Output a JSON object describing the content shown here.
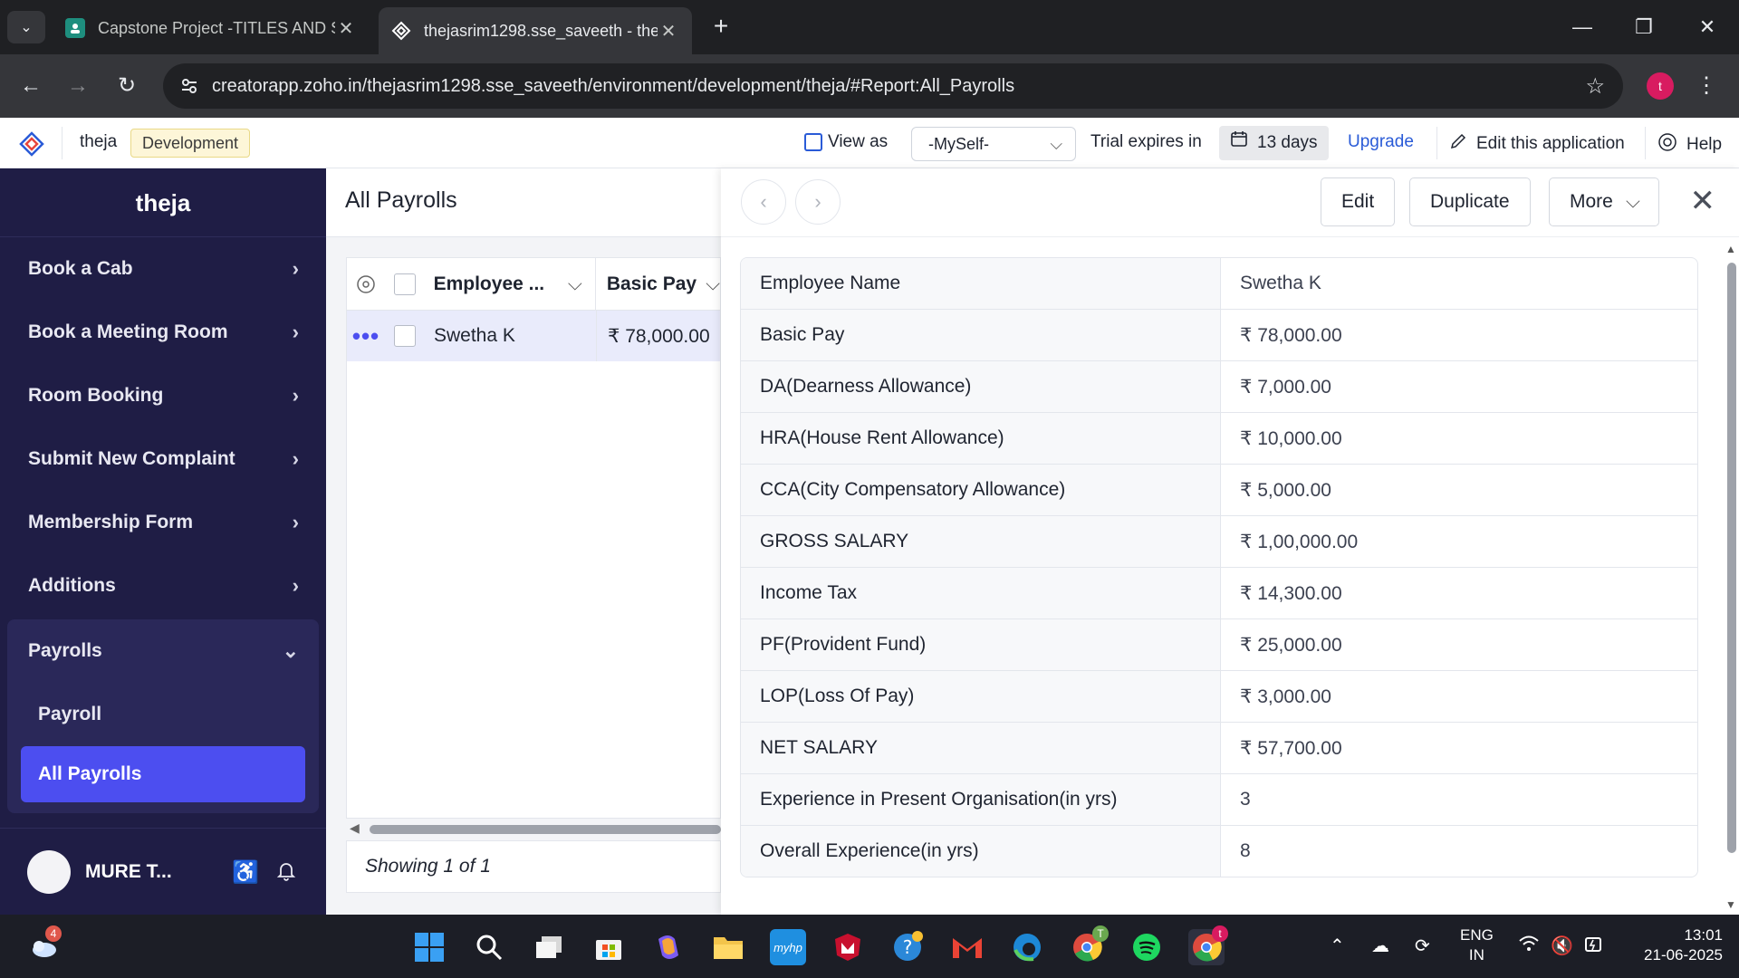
{
  "browser": {
    "tabs": [
      {
        "title": "Capstone Project -TITLES AND S",
        "active": false
      },
      {
        "title": "thejasrim1298.sse_saveeth - the",
        "active": true
      }
    ],
    "url": "creatorapp.zoho.in/thejasrim1298.sse_saveeth/environment/development/theja/#Report:All_Payrolls",
    "profile_initial": "t"
  },
  "app_header": {
    "app_name": "theja",
    "env_badge": "Development",
    "view_as_label": "View as",
    "view_as_value": "-MySelf-",
    "trial_label": "Trial expires in",
    "trial_days": "13 days",
    "upgrade_label": "Upgrade",
    "edit_app_label": "Edit this application",
    "help_label": "Help"
  },
  "sidebar": {
    "title": "theja",
    "items": [
      {
        "label": "Book a Cab"
      },
      {
        "label": "Book a Meeting Room"
      },
      {
        "label": "Room Booking"
      },
      {
        "label": "Submit New Complaint"
      },
      {
        "label": "Membership Form"
      },
      {
        "label": "Additions"
      }
    ],
    "group": {
      "label": "Payrolls",
      "children": [
        {
          "label": "Payroll",
          "active": false
        },
        {
          "label": "All Payrolls",
          "active": true
        }
      ]
    },
    "user_name": "MURE T..."
  },
  "report": {
    "title": "All Payrolls",
    "columns": [
      "Employee ...",
      "Basic Pay"
    ],
    "rows": [
      {
        "employee": "Swetha K",
        "basic_pay": "₹ 78,000.00"
      }
    ],
    "footer": "Showing 1 of 1"
  },
  "detail": {
    "buttons": {
      "edit": "Edit",
      "duplicate": "Duplicate",
      "more": "More"
    },
    "fields": [
      {
        "label": "Employee Name",
        "value": "Swetha K"
      },
      {
        "label": "Basic Pay",
        "value": "₹ 78,000.00"
      },
      {
        "label": "DA(Dearness Allowance)",
        "value": "₹ 7,000.00"
      },
      {
        "label": "HRA(House Rent Allowance)",
        "value": "₹ 10,000.00"
      },
      {
        "label": "CCA(City Compensatory Allowance)",
        "value": "₹ 5,000.00"
      },
      {
        "label": "GROSS SALARY",
        "value": "₹ 1,00,000.00"
      },
      {
        "label": "Income Tax",
        "value": "₹ 14,300.00"
      },
      {
        "label": "PF(Provident Fund)",
        "value": "₹ 25,000.00"
      },
      {
        "label": "LOP(Loss Of Pay)",
        "value": "₹ 3,000.00"
      },
      {
        "label": "NET SALARY",
        "value": "₹ 57,700.00"
      },
      {
        "label": "Experience in Present Organisation(in yrs)",
        "value": "3"
      },
      {
        "label": "Overall Experience(in yrs)",
        "value": "8"
      }
    ]
  },
  "taskbar": {
    "weather_badge": "4",
    "lang_line1": "ENG",
    "lang_line2": "IN",
    "time": "13:01",
    "date": "21-06-2025"
  },
  "colors": {
    "sidebar_bg": "#1f1d45",
    "sidebar_active": "#4c4ef0",
    "accent_blue": "#2a5bd7",
    "dev_badge_bg": "#fdf6d8"
  }
}
